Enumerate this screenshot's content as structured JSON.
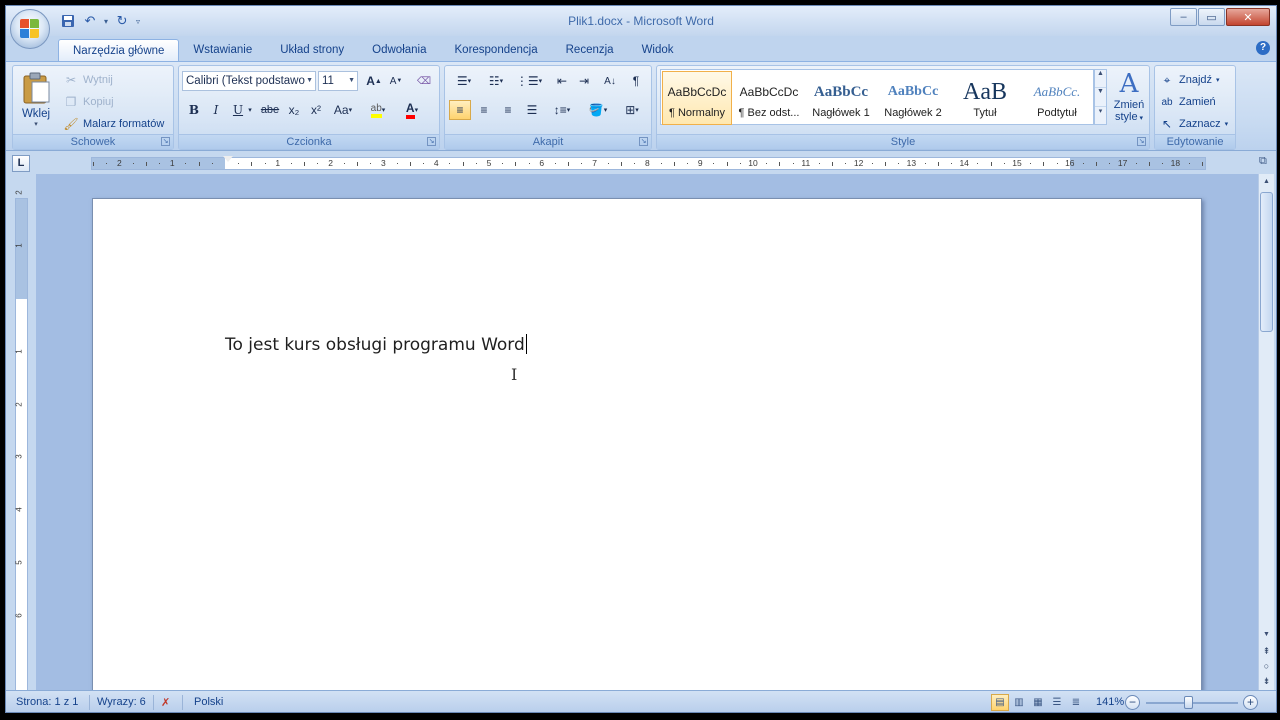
{
  "window": {
    "title": "Plik1.docx - Microsoft Word"
  },
  "quick_access": {
    "icons": [
      "save-icon",
      "undo-icon",
      "redo-icon",
      "customize-icon"
    ]
  },
  "tabs": [
    {
      "label": "Narzędzia główne",
      "active": true
    },
    {
      "label": "Wstawianie"
    },
    {
      "label": "Układ strony"
    },
    {
      "label": "Odwołania"
    },
    {
      "label": "Korespondencja"
    },
    {
      "label": "Recenzja"
    },
    {
      "label": "Widok"
    }
  ],
  "ribbon": {
    "clipboard": {
      "label": "Schowek",
      "paste": "Wklej",
      "cut": "Wytnij",
      "copy": "Kopiuj",
      "format_painter": "Malarz formatów"
    },
    "font": {
      "label": "Czcionka",
      "font_name": "Calibri (Tekst podstawo",
      "font_size": "11",
      "bold": "B",
      "italic": "I",
      "underline": "U",
      "strikethrough": "abe",
      "subscript": "x₂",
      "superscript": "x²",
      "change_case": "Aa",
      "grow": "A",
      "shrink": "A"
    },
    "paragraph": {
      "label": "Akapit"
    },
    "styles": {
      "label": "Style",
      "items": [
        {
          "sample": "AaBbCcDc",
          "name": "¶ Normalny",
          "selected": true
        },
        {
          "sample": "AaBbCcDc",
          "name": "¶ Bez odst..."
        },
        {
          "sample": "AaBbCc",
          "name": "Nagłówek 1"
        },
        {
          "sample": "AaBbCc",
          "name": "Nagłówek 2"
        },
        {
          "sample": "AaB",
          "name": "Tytuł"
        },
        {
          "sample": "AaBbCc.",
          "name": "Podtytuł"
        }
      ],
      "change_styles": "Zmień",
      "change_styles_2": "style"
    },
    "editing": {
      "label": "Edytowanie",
      "find": "Znajdź",
      "replace": "Zamień",
      "select": "Zaznacz"
    }
  },
  "ruler": {
    "tab_selector": "L",
    "numbers": [
      "2",
      "1",
      "1",
      "2",
      "3",
      "4",
      "5",
      "6",
      "7",
      "8",
      "9",
      "10",
      "11",
      "12",
      "13",
      "14",
      "15",
      "16",
      "17",
      "18"
    ],
    "vnumbers": [
      "2",
      "1",
      "1",
      "2",
      "3",
      "4",
      "5",
      "6"
    ]
  },
  "document": {
    "text": "To jest kurs obsługi programu Word"
  },
  "status": {
    "page": "Strona: 1 z 1",
    "words": "Wyrazy: 6",
    "language": "Polski",
    "zoom": "141%",
    "zoom_minus": "−",
    "zoom_plus": "+"
  },
  "colors": {
    "highlight": "#ffff00",
    "font_color": "#ff0000",
    "accent": "#15428b"
  }
}
